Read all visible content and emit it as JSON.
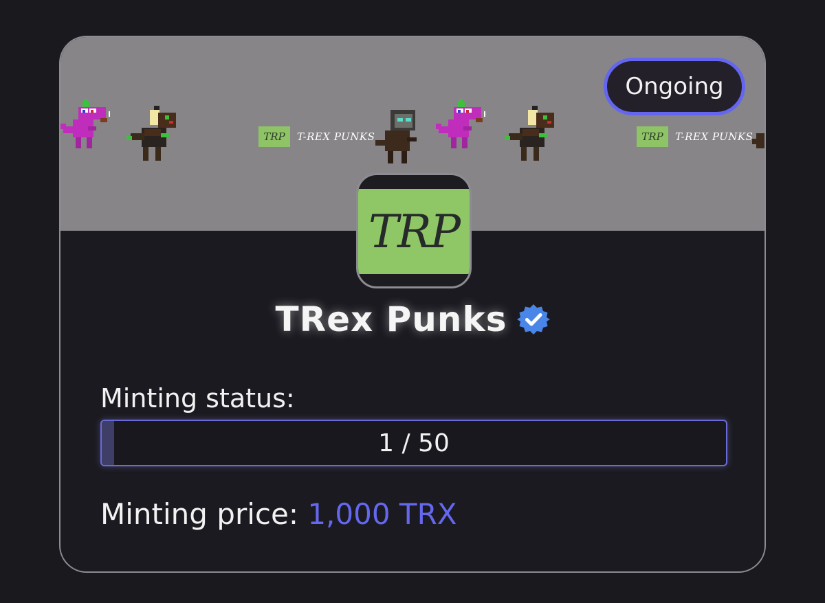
{
  "collection": {
    "name": "TRex Punks",
    "status_badge": "Ongoing",
    "logo_text": "TRP",
    "banner_brand_box": "TRP",
    "banner_brand_text": "T-REX PUNKS",
    "verified_icon": "verified-check-icon"
  },
  "minting": {
    "status_label": "Minting status:",
    "progress_text": "1 / 50",
    "progress_fraction": 0.02,
    "price_label": "Minting price:",
    "price_value": "1,000 TRX"
  },
  "colors": {
    "accent": "#6466f0",
    "logo_green": "#90c766",
    "verified_blue": "#4a86e8"
  }
}
